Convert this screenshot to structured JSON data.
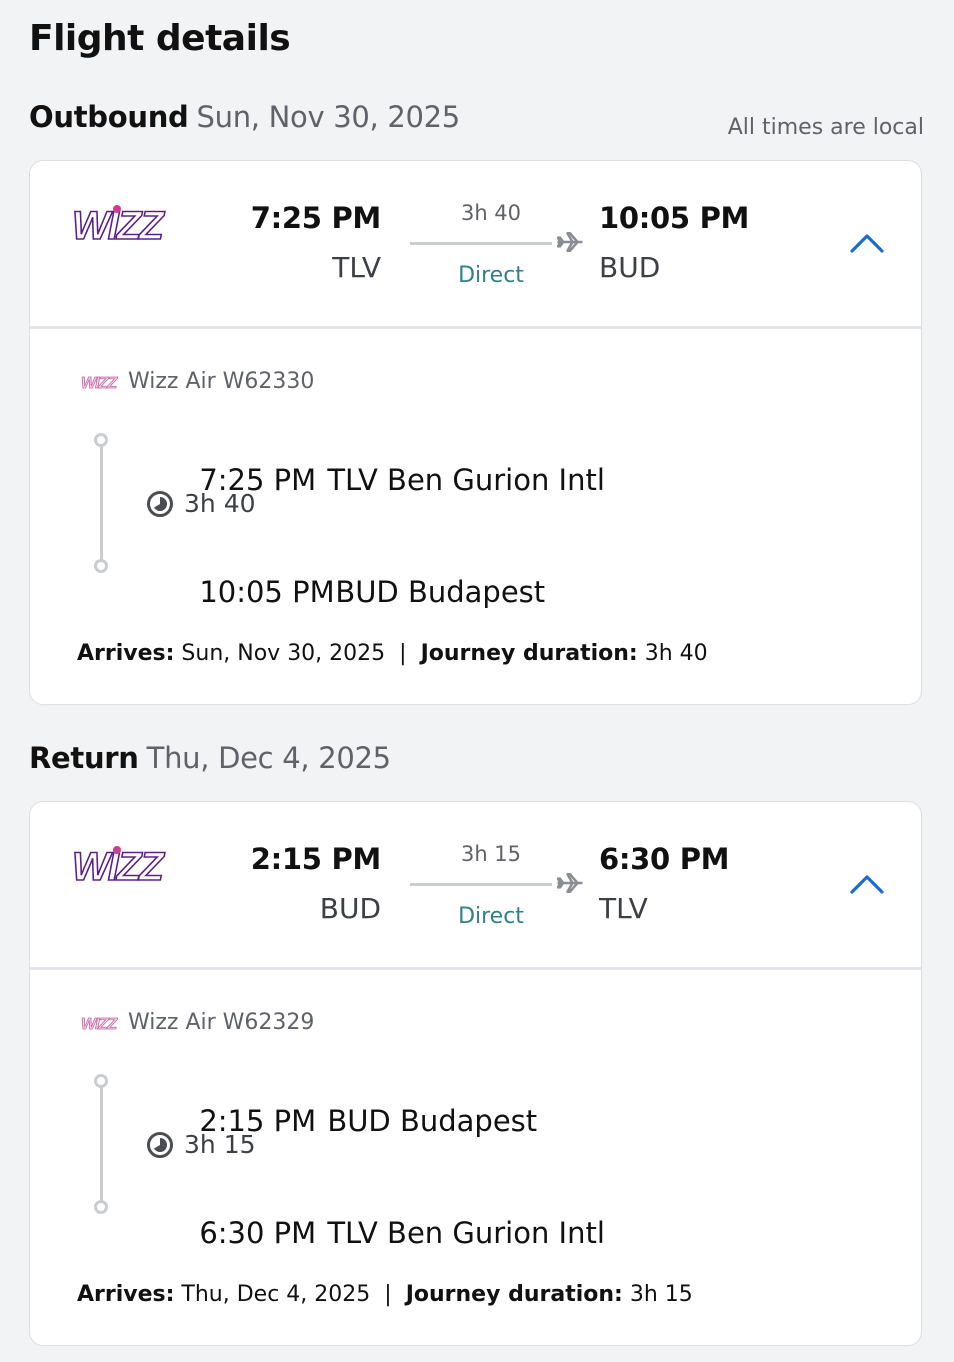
{
  "page": {
    "title": "Flight details",
    "times_note": "All times are local"
  },
  "colors": {
    "brand_purple": "#5c1f8a",
    "brand_pink": "#d23c8c",
    "accent_blue": "#1a6bd6",
    "stops_teal": "#2f8087"
  },
  "outbound": {
    "label": "Outbound",
    "date": "Sun, Nov 30, 2025",
    "logo": "wizz-air-logo",
    "dep_time": "7:25 PM",
    "dep_code": "TLV",
    "duration": "3h 40",
    "stops": "Direct",
    "arr_time": "10:05 PM",
    "arr_code": "BUD",
    "expanded": true,
    "airline": "Wizz Air W62330",
    "segment_dep_time": "7:25 PM",
    "segment_dep_place": "TLV Ben Gurion Intl",
    "segment_duration": "3h 40",
    "segment_arr_time": "10:05 PM",
    "segment_arr_place": "BUD Budapest",
    "arrives_label": "Arrives:",
    "arrives_value": "Sun, Nov 30, 2025",
    "separator": "|",
    "journey_label": "Journey duration:",
    "journey_value": "3h 40"
  },
  "return": {
    "label": "Return",
    "date": "Thu, Dec 4, 2025",
    "logo": "wizz-air-logo",
    "dep_time": "2:15 PM",
    "dep_code": "BUD",
    "duration": "3h 15",
    "stops": "Direct",
    "arr_time": "6:30 PM",
    "arr_code": "TLV",
    "expanded": true,
    "airline": "Wizz Air W62329",
    "segment_dep_time": "2:15 PM",
    "segment_dep_place": "BUD Budapest",
    "segment_duration": "3h 15",
    "segment_arr_time": "6:30 PM",
    "segment_arr_place": "TLV Ben Gurion Intl",
    "arrives_label": "Arrives:",
    "arrives_value": "Thu, Dec 4, 2025",
    "separator": "|",
    "journey_label": "Journey duration:",
    "journey_value": "3h 15"
  }
}
